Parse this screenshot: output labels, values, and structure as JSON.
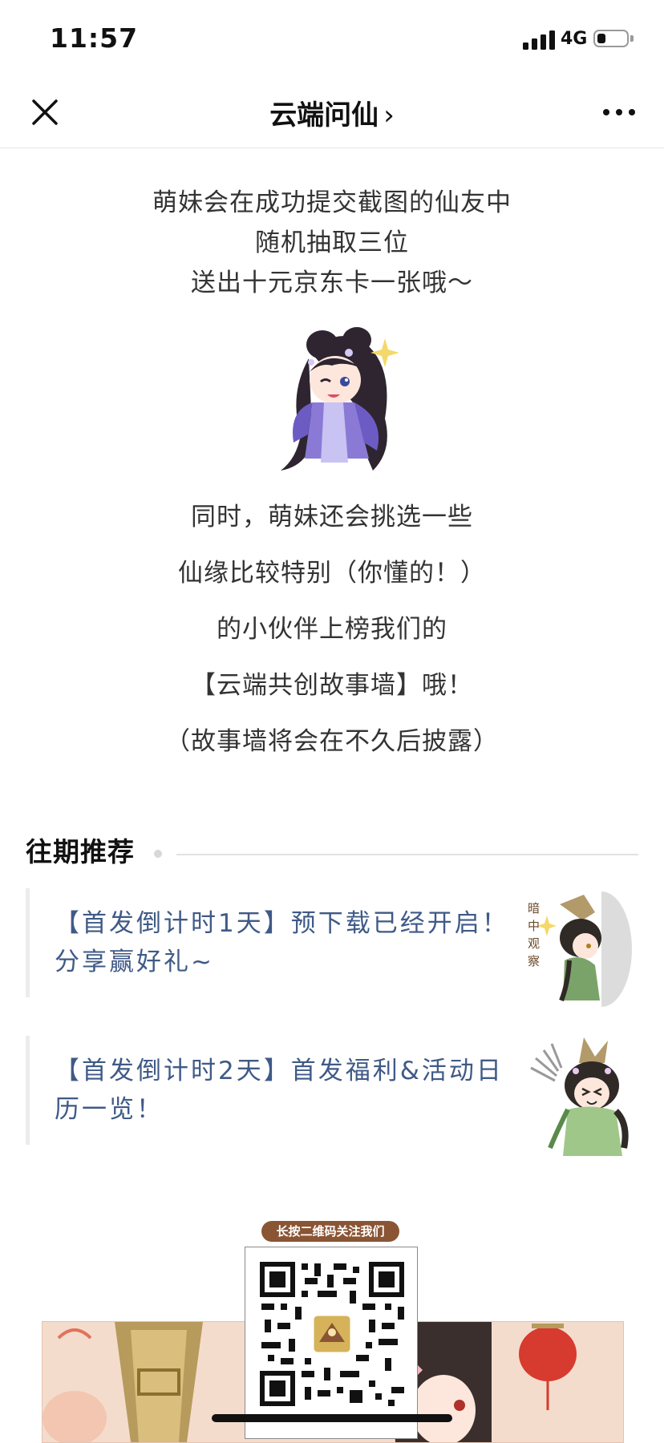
{
  "status_bar": {
    "time": "11:57",
    "network": "4G",
    "battery_level": 0.3
  },
  "nav": {
    "title": "云端问仙",
    "chevron": "›",
    "close_icon": "close-icon",
    "more_icon": "more-dots-icon"
  },
  "intro": {
    "lines": [
      "萌妹会在成功提交截图的仙友中",
      "随机抽取三位",
      "送出十元京东卡一张哦～"
    ]
  },
  "story": {
    "lines": [
      "同时，萌妹还会挑选一些",
      "仙缘比较特别（你懂的！）",
      "的小伙伴上榜我们的",
      "【云端共创故事墙】哦！",
      "（故事墙将会在不久后披露）"
    ]
  },
  "recommend": {
    "title": "往期推荐",
    "articles": [
      {
        "title": "【首发倒计时1天】预下载已经开启！分享赢好礼~",
        "thumb_text": "暗中观察"
      },
      {
        "title": "【首发倒计时2天】首发福利&活动日历一览！"
      }
    ]
  },
  "qr": {
    "label": "长按二维码关注我们"
  },
  "colors": {
    "link": "#3f5a87",
    "qr_label_bg": "#8a5534",
    "banner_bg": "#f4dccd"
  }
}
